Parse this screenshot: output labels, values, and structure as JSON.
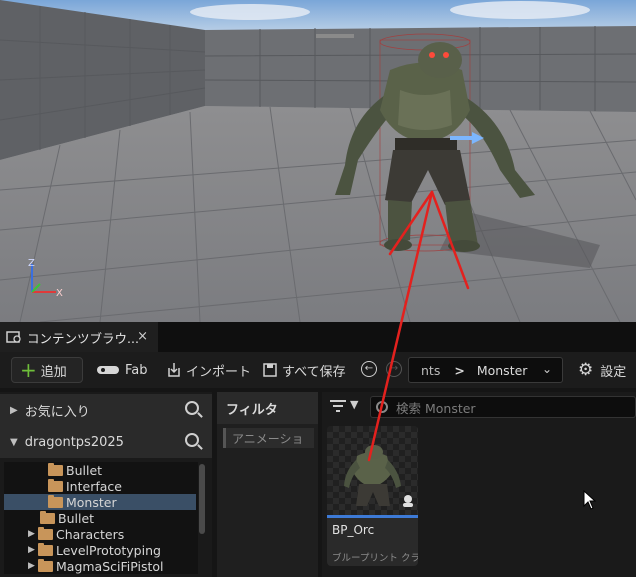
{
  "tab": {
    "title": "コンテンツブラウ...",
    "close": "×"
  },
  "toolbar": {
    "add_label": "追加",
    "fab_label": "Fab",
    "import_label": "インポート",
    "saveall_label": "すべて保存",
    "settings_label": "設定"
  },
  "path": {
    "crumb_prev": "nts",
    "crumb_sep": ">",
    "crumb_current": "Monster"
  },
  "left_panel": {
    "favorites_label": "お気に入り",
    "project_label": "dragontps2025",
    "tree": [
      {
        "label": "Bullet",
        "depth": 2
      },
      {
        "label": "Interface",
        "depth": 2
      },
      {
        "label": "Monster",
        "depth": 2,
        "selected": true
      },
      {
        "label": "Bullet",
        "depth": 0
      },
      {
        "label": "Characters",
        "depth": 1
      },
      {
        "label": "LevelPrototyping",
        "depth": 1
      },
      {
        "label": "MagmaSciFiPistol",
        "depth": 1
      }
    ]
  },
  "filter": {
    "header": "フィルタ",
    "chip": "アニメーショ"
  },
  "asset_area": {
    "search_placeholder": "検索 Monster"
  },
  "asset": {
    "name": "BP_Orc",
    "type": "ブループリント クラス"
  },
  "viewport": {
    "axis_z": "Z",
    "axis_x": "X"
  },
  "colors": {
    "accent_blue": "#3d7ad6",
    "add_green": "#6fbf3a",
    "folder": "#c8955a",
    "annotation_red": "#e3211e"
  }
}
